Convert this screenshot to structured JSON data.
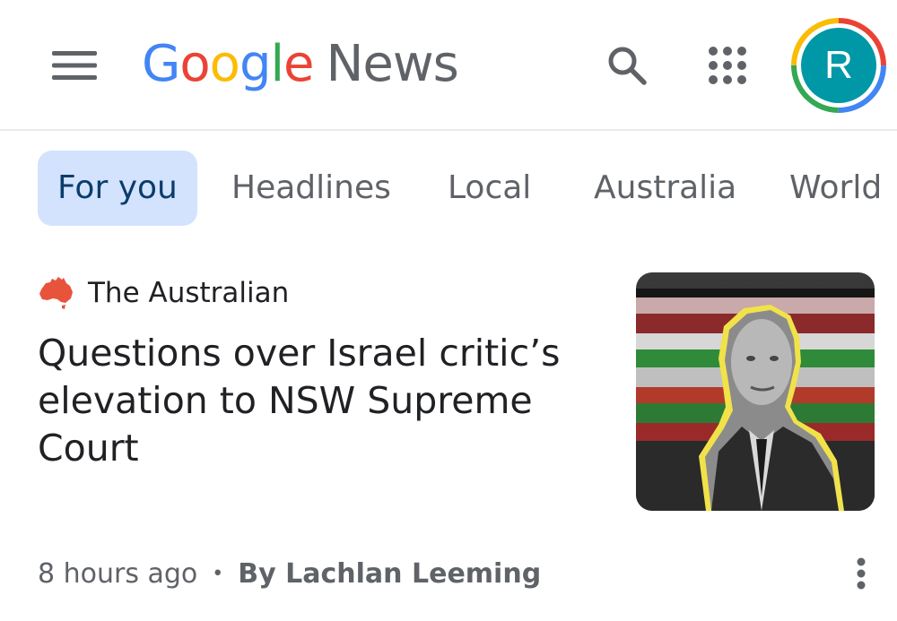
{
  "app": {
    "logo_google_letters": [
      "G",
      "o",
      "o",
      "g",
      "l",
      "e"
    ],
    "logo_google_colors": [
      "#4285F4",
      "#EA4335",
      "#FBBC05",
      "#4285F4",
      "#34A853",
      "#EA4335"
    ],
    "logo_product": "News",
    "avatar_initial": "R"
  },
  "icons": {
    "menu": "menu-icon",
    "search": "search-icon",
    "apps": "apps-grid-icon",
    "source": "australia-map-icon",
    "more": "more-vertical-icon"
  },
  "tabs": [
    {
      "label": "For you",
      "active": true
    },
    {
      "label": "Headlines",
      "active": false
    },
    {
      "label": "Local",
      "active": false
    },
    {
      "label": "Australia",
      "active": false
    },
    {
      "label": "World",
      "active": false
    }
  ],
  "article": {
    "source": "The Australian",
    "headline": "Questions over Israel critic’s elevation to NSW Supreme Court",
    "time": "8 hours ago",
    "separator": "•",
    "author": "By Lachlan Leeming"
  },
  "colors": {
    "accent_tab_bg": "#d3e3fd",
    "accent_tab_text": "#0b3c6b",
    "text_primary": "#202124",
    "text_secondary": "#5f6368",
    "avatar_bg": "#0097a7"
  }
}
